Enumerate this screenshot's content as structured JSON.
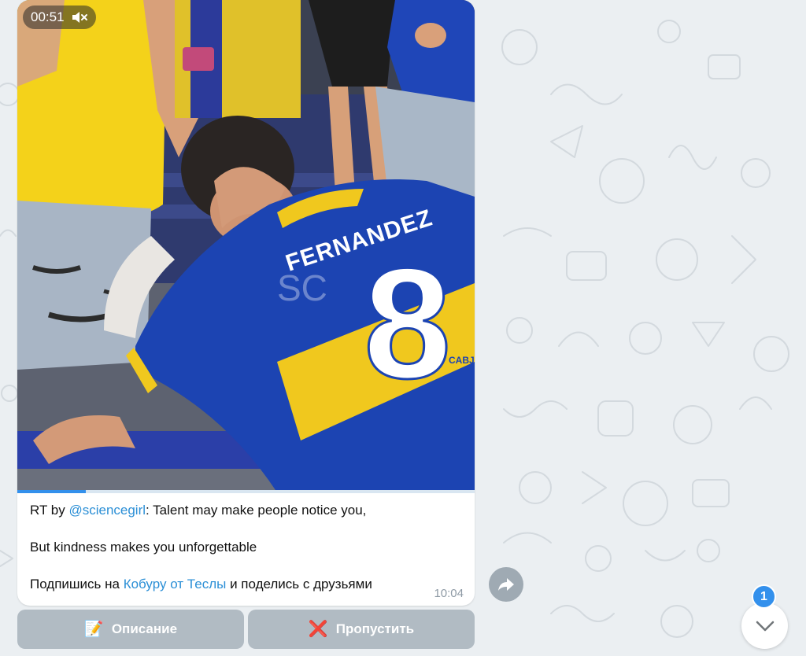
{
  "message": {
    "video": {
      "duration": "00:51",
      "muted": true,
      "progress_fraction": 0.15,
      "jersey_name": "FERNANDEZ",
      "jersey_number": "8",
      "watermark": "SC",
      "jersey_small_text": "CABJ"
    },
    "caption": {
      "prefix": "RT by ",
      "mention": "@sciencegirl",
      "line1_rest": ": Talent may make people notice you,",
      "line2": "But kindness makes you unforgettable",
      "line3_prefix": "Подпишись на ",
      "line3_link": "Кобуру от Теслы",
      "line3_suffix": " и поделись с друзьями"
    },
    "time": "10:04"
  },
  "keyboard": {
    "buttons": [
      {
        "emoji": "📝",
        "label": "Описание"
      },
      {
        "emoji": "❌",
        "label": "Пропустить"
      }
    ]
  },
  "scroll_down": {
    "unread_count": "1"
  },
  "icons": {
    "mute": "speaker-muted-icon",
    "share": "share-arrow-icon",
    "scroll": "chevron-down-icon"
  },
  "colors": {
    "accent": "#3390ec",
    "link": "#2b8fd6",
    "background": "#ebeff2"
  }
}
